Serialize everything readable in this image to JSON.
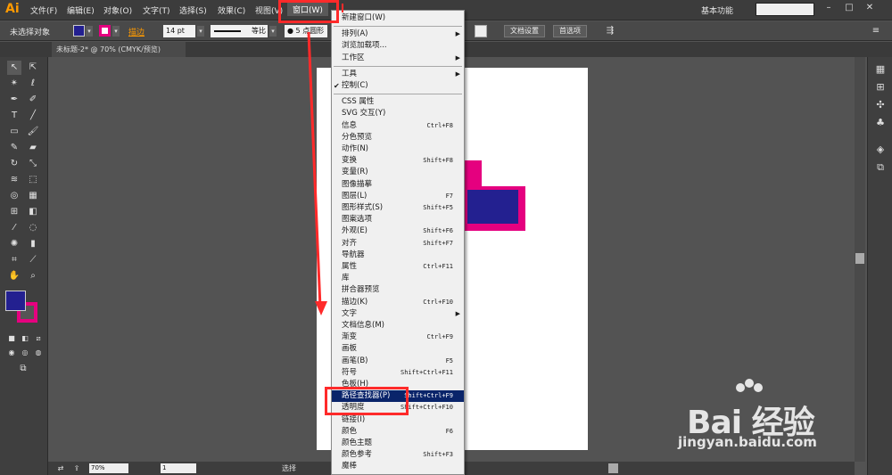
{
  "app": {
    "logo": "Ai",
    "workspace": "基本功能"
  },
  "menubar": [
    "文件(F)",
    "编辑(E)",
    "对象(O)",
    "文字(T)",
    "选择(S)",
    "效果(C)",
    "视图(V)",
    "窗口(W)"
  ],
  "window_controls": [
    "–",
    "□",
    "✕"
  ],
  "control_bar": {
    "selection": "未选择对象",
    "stroke_label": "描边",
    "stroke_width": "14 pt",
    "stroke_profile": "等比",
    "brush_profile": "● 5 点圆形",
    "doc_setup": "文档设置",
    "preferences": "首选项"
  },
  "document_tab": "未标题-2* @ 70% (CMYK/预览)",
  "status_bar": {
    "zoom": "70%",
    "page": "1",
    "status": "选择"
  },
  "window_menu": {
    "items": [
      {
        "label": "新建窗口(W)",
        "shortcut": ""
      },
      {
        "label": "排列(A)",
        "shortcut": "",
        "submenu": true
      },
      {
        "label": "浏览加载项...",
        "shortcut": ""
      },
      {
        "label": "工作区",
        "shortcut": "",
        "submenu": true
      },
      {
        "label": "工具",
        "shortcut": "",
        "submenu": true
      },
      {
        "label": "控制(C)",
        "shortcut": "",
        "checked": true
      },
      {
        "label": "CSS 属性",
        "shortcut": ""
      },
      {
        "label": "SVG 交互(Y)",
        "shortcut": ""
      },
      {
        "label": "信息",
        "shortcut": "Ctrl+F8"
      },
      {
        "label": "分色预览",
        "shortcut": ""
      },
      {
        "label": "动作(N)",
        "shortcut": ""
      },
      {
        "label": "变换",
        "shortcut": "Shift+F8"
      },
      {
        "label": "变量(R)",
        "shortcut": ""
      },
      {
        "label": "图像描摹",
        "shortcut": ""
      },
      {
        "label": "图层(L)",
        "shortcut": "F7"
      },
      {
        "label": "图形样式(S)",
        "shortcut": "Shift+F5"
      },
      {
        "label": "图案选项",
        "shortcut": ""
      },
      {
        "label": "外观(E)",
        "shortcut": "Shift+F6"
      },
      {
        "label": "对齐",
        "shortcut": "Shift+F7"
      },
      {
        "label": "导航器",
        "shortcut": ""
      },
      {
        "label": "属性",
        "shortcut": "Ctrl+F11"
      },
      {
        "label": "库",
        "shortcut": ""
      },
      {
        "label": "拼合器预览",
        "shortcut": ""
      },
      {
        "label": "描边(K)",
        "shortcut": "Ctrl+F10"
      },
      {
        "label": "文字",
        "shortcut": "",
        "submenu": true
      },
      {
        "label": "文档信息(M)",
        "shortcut": ""
      },
      {
        "label": "渐变",
        "shortcut": "Ctrl+F9"
      },
      {
        "label": "画板",
        "shortcut": ""
      },
      {
        "label": "画笔(B)",
        "shortcut": "F5"
      },
      {
        "label": "符号",
        "shortcut": "Shift+Ctrl+F11"
      },
      {
        "label": "色板(H)",
        "shortcut": ""
      },
      {
        "label": "路径查找器(P)",
        "shortcut": "Shift+Ctrl+F9",
        "highlighted": true
      },
      {
        "label": "透明度",
        "shortcut": "Shift+Ctrl+F10"
      },
      {
        "label": "链接(I)",
        "shortcut": ""
      },
      {
        "label": "颜色",
        "shortcut": "F6"
      },
      {
        "label": "颜色主题",
        "shortcut": ""
      },
      {
        "label": "颜色参考",
        "shortcut": "Shift+F3"
      },
      {
        "label": "魔棒",
        "shortcut": ""
      }
    ]
  },
  "colors": {
    "fill": "#232090",
    "stroke": "#e5007f",
    "highlight": "#0a246a",
    "annotation": "#ff2a2a"
  },
  "watermark": {
    "brand": "Bai 经验",
    "url": "jingyan.baidu.com"
  }
}
